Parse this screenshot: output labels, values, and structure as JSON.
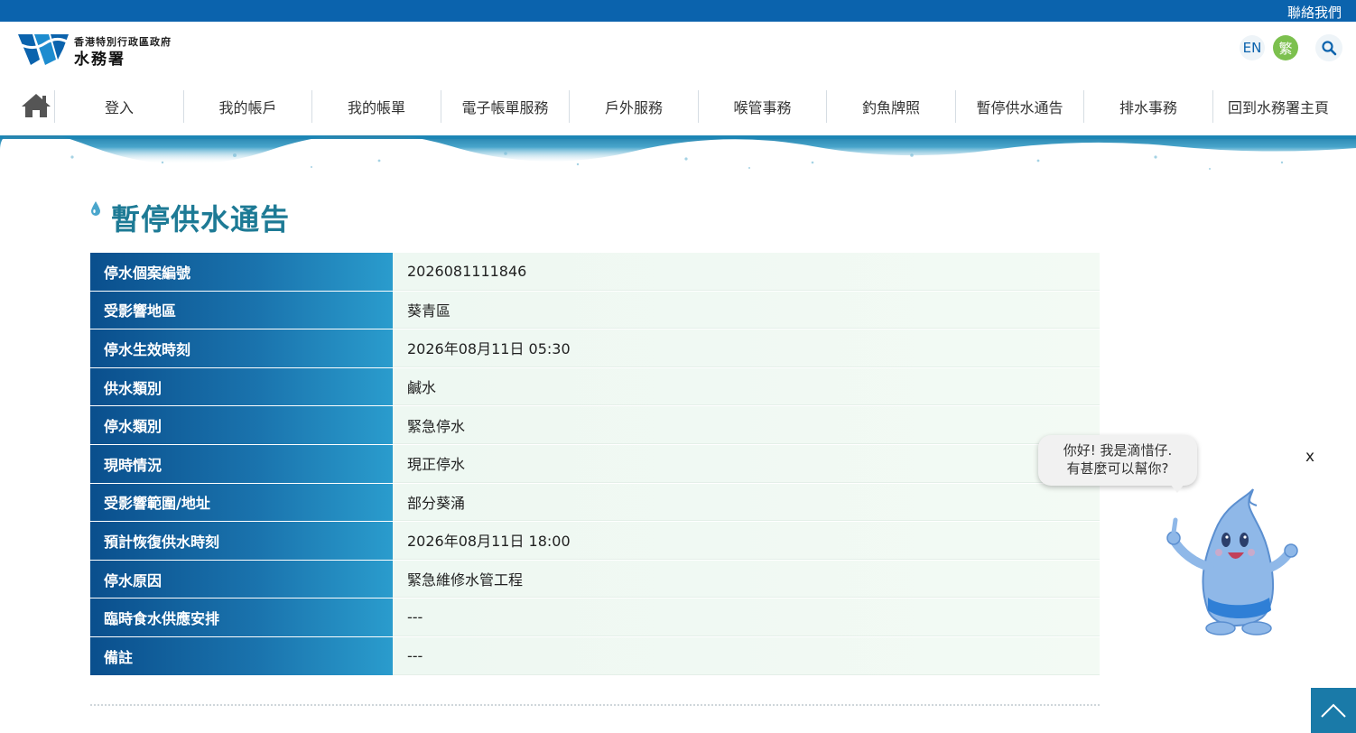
{
  "topbar": {
    "contact_label": "聯絡我們"
  },
  "header": {
    "org_sub": "香港特別行政區政府",
    "org_main": "水務署",
    "lang_en": "EN",
    "lang_tc": "繁"
  },
  "nav": {
    "items": [
      {
        "label": "登入"
      },
      {
        "label": "我的帳戶"
      },
      {
        "label": "我的帳單"
      },
      {
        "label": "電子帳單服務"
      },
      {
        "label": "戶外服務"
      },
      {
        "label": "喉管事務"
      },
      {
        "label": "釣魚牌照"
      },
      {
        "label": "暫停供水通告"
      },
      {
        "label": "排水事務"
      },
      {
        "label": "回到水務署主頁"
      }
    ]
  },
  "page": {
    "title": "暫停供水通告"
  },
  "notice": {
    "rows": [
      {
        "label": "停水個案編號",
        "value": "2026081111846"
      },
      {
        "label": "受影響地區",
        "value": "葵青區"
      },
      {
        "label": "停水生效時刻",
        "value": "2026年08月11日 05:30"
      },
      {
        "label": "供水類別",
        "value": "鹹水"
      },
      {
        "label": "停水類別",
        "value": "緊急停水"
      },
      {
        "label": "現時情況",
        "value": "現正停水"
      },
      {
        "label": "受影響範圍/地址",
        "value": "部分葵涌"
      },
      {
        "label": "預計恢復供水時刻",
        "value": "2026年08月11日 18:00"
      },
      {
        "label": "停水原因",
        "value": "緊急維修水管工程"
      },
      {
        "label": "臨時食水供應安排",
        "value": "---"
      },
      {
        "label": "備註",
        "value": "---"
      }
    ]
  },
  "chatbot": {
    "line1": "你好! 我是滴惜仔.",
    "line2": "有甚麼可以幫你?",
    "close_label": "x"
  },
  "colors": {
    "brand_blue": "#0b63ad",
    "title_teal": "#1d7a95",
    "lang_green": "#7cc04e"
  }
}
